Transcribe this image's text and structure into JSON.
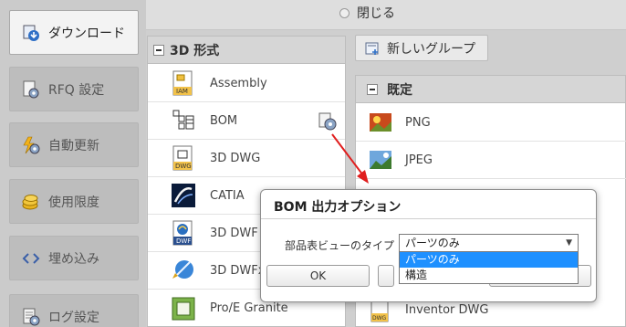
{
  "sidebar": {
    "items": [
      {
        "label": "ダウンロード",
        "icon": "download-icon"
      },
      {
        "label": "RFQ 設定",
        "icon": "rfq-settings-icon"
      },
      {
        "label": "自動更新",
        "icon": "auto-update-icon"
      },
      {
        "label": "使用限度",
        "icon": "usage-limit-icon"
      },
      {
        "label": "埋め込み",
        "icon": "embed-icon"
      },
      {
        "label": "ログ設定",
        "icon": "log-settings-icon"
      }
    ]
  },
  "topbar": {
    "close_label": "閉じる"
  },
  "format_panel": {
    "title": "3D 形式",
    "items": [
      {
        "label": "Assembly",
        "icon": "iam-file-icon"
      },
      {
        "label": "BOM",
        "icon": "bom-icon"
      },
      {
        "label": "3D DWG",
        "icon": "dwg-file-icon"
      },
      {
        "label": "CATIA",
        "icon": "catia-icon"
      },
      {
        "label": "3D DWF",
        "icon": "dwf-file-icon"
      },
      {
        "label": "3D DWFx",
        "icon": "dwfx-icon"
      },
      {
        "label": "Pro/E Granite",
        "icon": "proe-granite-icon"
      }
    ]
  },
  "new_group_button": {
    "label": "新しいグループ"
  },
  "group_panel": {
    "title": "既定",
    "items": [
      {
        "label": "PNG",
        "icon": "png-image-icon"
      },
      {
        "label": "JPEG",
        "icon": "jpeg-image-icon"
      },
      {
        "label": "Inventor DWG",
        "icon": "inventor-dwg-icon"
      }
    ]
  },
  "dialog": {
    "title": "BOM 出力オプション",
    "view_type_label": "部品表ビューのタイプ",
    "selected_value": "パーツのみ",
    "options": [
      "パーツのみ",
      "構造"
    ],
    "ok_label": "OK"
  },
  "colors": {
    "accent_red": "#e01e1e",
    "selection_blue": "#1e90ff"
  }
}
